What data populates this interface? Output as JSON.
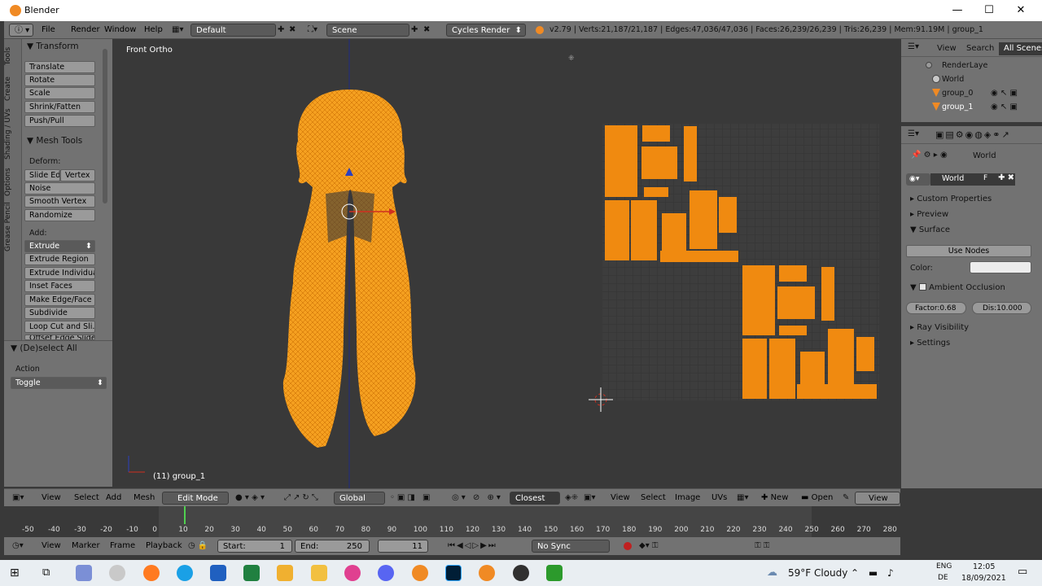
{
  "window": {
    "title": "Blender",
    "minimize": "—",
    "maximize": "☐",
    "close": "✕"
  },
  "topbar": {
    "menus": [
      "File",
      "Render",
      "Window",
      "Help"
    ],
    "layout": "Default",
    "scene": "Scene",
    "engine": "Cycles Render",
    "stats": "v2.79 | Verts:21,187/21,187 | Edges:47,036/47,036 | Faces:26,239/26,239 | Tris:26,239 | Mem:91.19M | group_1"
  },
  "tabs": [
    "Tools",
    "Create",
    "Shading / UVs",
    "Options",
    "Grease Pencil"
  ],
  "toolshelf": {
    "transform_header": "Transform",
    "transform": [
      "Translate",
      "Rotate",
      "Scale",
      "Shrink/Fatten",
      "Push/Pull"
    ],
    "mesh_tools_header": "Mesh Tools",
    "deform_label": "Deform:",
    "slide_edge": "Slide Ed",
    "vertex": "Vertex",
    "deform": [
      "Noise",
      "Smooth Vertex",
      "Randomize"
    ],
    "add_label": "Add:",
    "extrude": "Extrude",
    "add": [
      "Extrude Region",
      "Extrude Individual",
      "Inset Faces",
      "Make Edge/Face",
      "Subdivide",
      "Loop Cut and Sli...",
      "Offset Edge Slide"
    ],
    "deselect_header": "(De)select All",
    "action_label": "Action",
    "action_value": "Toggle"
  },
  "viewport": {
    "view_name": "Front Ortho",
    "object_label": "(11) group_1"
  },
  "outliner": {
    "menus": [
      "View",
      "Search",
      "All Scenes"
    ],
    "items": [
      "RenderLaye",
      "World",
      "group_0",
      "group_1"
    ]
  },
  "properties": {
    "breadcrumb": "World",
    "world_field": "World",
    "f_label": "F",
    "sections": [
      "Custom Properties",
      "Preview",
      "Surface"
    ],
    "use_nodes": "Use Nodes",
    "color_label": "Color:",
    "ao_header": "Ambient Occlusion",
    "factor": "Factor:0.68",
    "dist": "Dis:10.000",
    "sections2": [
      "Ray Visibility",
      "Settings"
    ]
  },
  "editbar": {
    "menus": [
      "View",
      "Select",
      "Add",
      "Mesh"
    ],
    "mode": "Edit Mode",
    "orientation": "Global",
    "snap": "Closest",
    "uv_menus": [
      "View",
      "Select",
      "Image",
      "UVs"
    ],
    "new": "New",
    "open": "Open",
    "view": "View"
  },
  "timeline": {
    "ticks": [
      "-50",
      "-40",
      "-30",
      "-20",
      "-10",
      "0",
      "10",
      "20",
      "30",
      "40",
      "50",
      "60",
      "70",
      "80",
      "90",
      "100",
      "110",
      "120",
      "130",
      "140",
      "150",
      "160",
      "170",
      "180",
      "190",
      "200",
      "210",
      "220",
      "230",
      "240",
      "250",
      "260",
      "270",
      "280"
    ],
    "menus": [
      "View",
      "Marker",
      "Frame",
      "Playback"
    ],
    "start": "Start:",
    "start_val": "1",
    "end": "End:",
    "end_val": "250",
    "current": "11",
    "sync": "No Sync"
  },
  "taskbar": {
    "weather": "59°F  Cloudy",
    "lang1": "ENG",
    "lang2": "DE",
    "time": "12:05",
    "date": "18/09/2021"
  },
  "colors": {
    "accent": "#f08a24",
    "mesh": "#f5a020",
    "uv": "#f08a10"
  }
}
